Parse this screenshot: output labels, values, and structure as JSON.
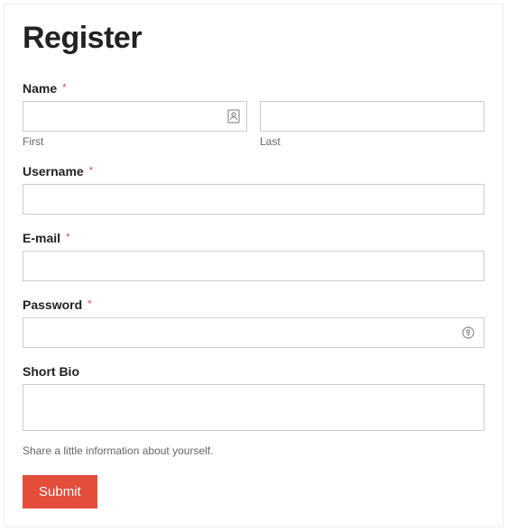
{
  "title": "Register",
  "required_marker": "*",
  "fields": {
    "name": {
      "label": "Name",
      "required": true,
      "first_sublabel": "First",
      "last_sublabel": "Last",
      "first_value": "",
      "last_value": ""
    },
    "username": {
      "label": "Username",
      "required": true,
      "value": ""
    },
    "email": {
      "label": "E-mail",
      "required": true,
      "value": ""
    },
    "password": {
      "label": "Password",
      "required": true,
      "value": ""
    },
    "bio": {
      "label": "Short Bio",
      "required": false,
      "value": "",
      "hint": "Share a little information about yourself."
    }
  },
  "submit_label": "Submit"
}
